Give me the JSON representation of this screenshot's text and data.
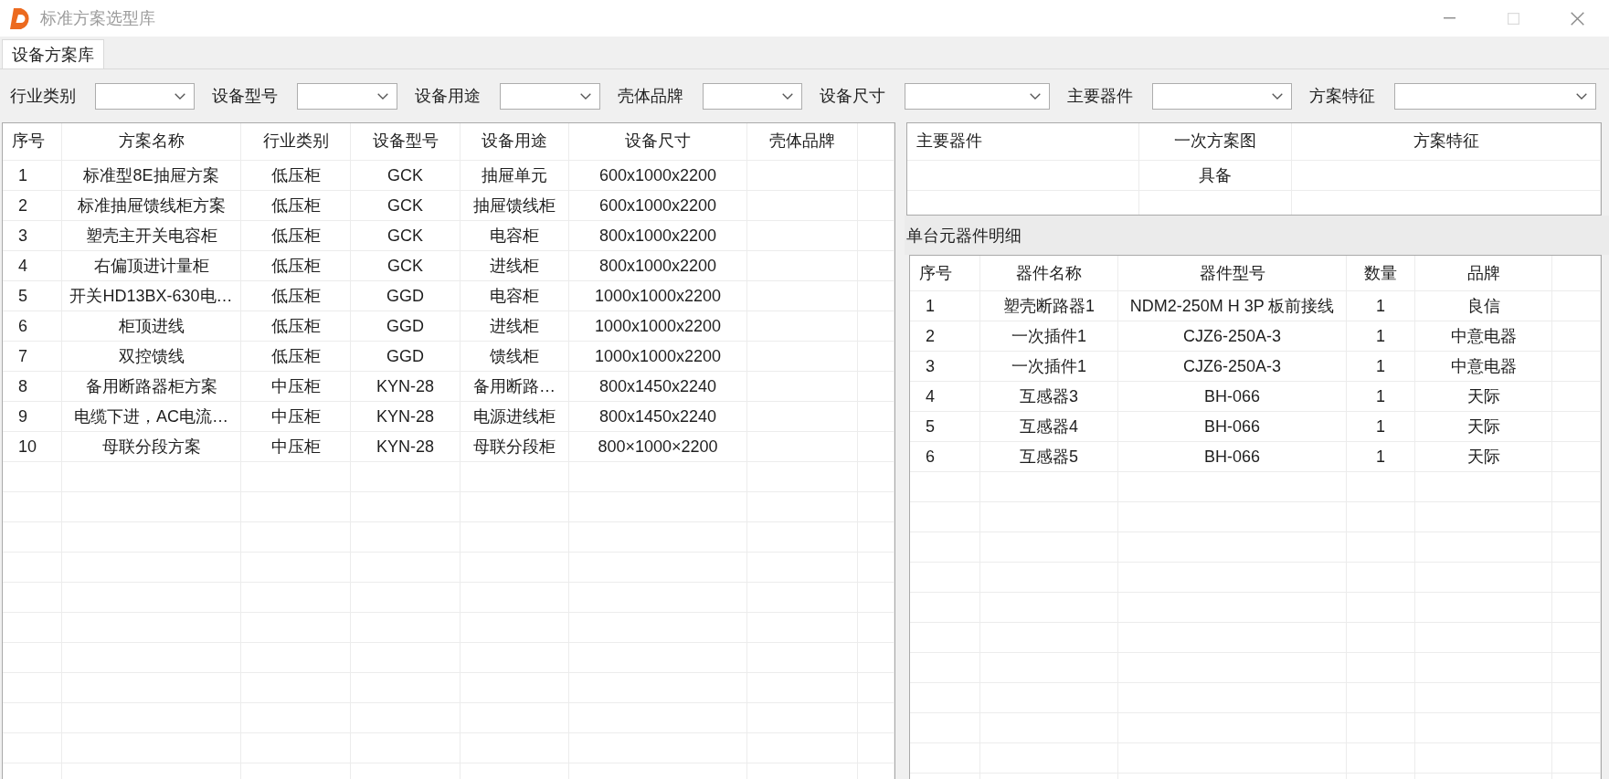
{
  "window": {
    "title": "标准方案选型库",
    "controls": [
      {
        "kind": "minimize",
        "disabled": false
      },
      {
        "kind": "maximize",
        "disabled": true
      },
      {
        "kind": "close",
        "disabled": false
      }
    ]
  },
  "tabs": [
    {
      "label": "设备方案库",
      "selected": true
    }
  ],
  "filters": [
    {
      "label": "行业类别"
    },
    {
      "label": "设备型号"
    },
    {
      "label": "设备用途"
    },
    {
      "label": "壳体品牌"
    },
    {
      "label": "设备尺寸"
    },
    {
      "label": "主要器件"
    },
    {
      "label": "方案特征"
    }
  ],
  "scheme_table": {
    "columns": [
      "序号",
      "方案名称",
      "行业类别",
      "设备型号",
      "设备用途",
      "设备尺寸",
      "壳体品牌"
    ],
    "rows": [
      [
        "1",
        "标准型8E抽屉方案",
        "低压柜",
        "GCK",
        "抽屉单元",
        "600x1000x2200"
      ],
      [
        "2",
        "标准抽屉馈线柜方案",
        "低压柜",
        "GCK",
        "抽屉馈线柜",
        "600x1000x2200"
      ],
      [
        "3",
        "塑壳主开关电容柜",
        "低压柜",
        "GCK",
        "电容柜",
        "800x1000x2200"
      ],
      [
        "4",
        "右偏顶进计量柜",
        "低压柜",
        "GCK",
        "进线柜",
        "800x1000x2200"
      ],
      [
        "5",
        "开关HD13BX-630电…",
        "低压柜",
        "GGD",
        "电容柜",
        "1000x1000x2200"
      ],
      [
        "6",
        "柜顶进线",
        "低压柜",
        "GGD",
        "进线柜",
        "1000x1000x2200"
      ],
      [
        "7",
        "双控馈线",
        "低压柜",
        "GGD",
        "馈线柜",
        "1000x1000x2200"
      ],
      [
        "8",
        "备用断路器柜方案",
        "中压柜",
        "KYN-28",
        "备用断路…",
        "800x1450x2240"
      ],
      [
        "9",
        "电缆下进，AC电流…",
        "中压柜",
        "KYN-28",
        "电源进线柜",
        "800x1450x2240"
      ],
      [
        "10",
        "母联分段方案",
        "中压柜",
        "KYN-28",
        "母联分段柜",
        "800×1000×2200"
      ]
    ]
  },
  "scheme_detail_table": {
    "columns": [
      "主要器件",
      "一次方案图",
      "方案特征"
    ],
    "rows": [
      [
        null,
        "具备"
      ]
    ]
  },
  "component_section": {
    "title": "单台元器件明细",
    "table": {
      "columns": [
        "序号",
        "器件名称",
        "器件型号",
        "数量",
        "品牌"
      ],
      "rows": [
        [
          "1",
          "塑壳断路器1",
          "NDM2-250M H 3P 板前接线",
          "1",
          "良信"
        ],
        [
          "2",
          "一次插件1",
          "CJZ6-250A-3",
          "1",
          "中意电器"
        ],
        [
          "3",
          "一次插件1",
          "CJZ6-250A-3",
          "1",
          "中意电器"
        ],
        [
          "4",
          "互感器3",
          "BH-066",
          "1",
          "天际"
        ],
        [
          "5",
          "互感器4",
          "BH-066",
          "1",
          "天际"
        ],
        [
          "6",
          "互感器5",
          "BH-066",
          "1",
          "天际"
        ]
      ]
    }
  }
}
